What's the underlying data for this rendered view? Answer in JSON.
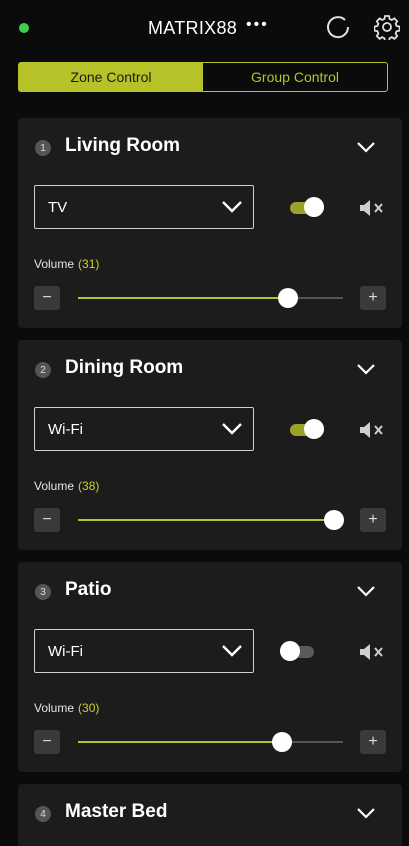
{
  "header": {
    "title": "MATRIX88",
    "menu": "•••",
    "status_color": "#3fcf4a",
    "icons": [
      "refresh-icon",
      "gear-icon"
    ]
  },
  "tabs": [
    {
      "label": "Zone Control",
      "active": true
    },
    {
      "label": "Group Control",
      "active": false
    }
  ],
  "accent": "#b6c227",
  "zones": [
    {
      "number": "1",
      "name": "Living Room",
      "source": "TV",
      "power": true,
      "volume_label": "Volume",
      "volume_value": "(31)",
      "volume_fraction": 0.79,
      "muted": false
    },
    {
      "number": "2",
      "name": "Dining Room",
      "source": "Wi-Fi",
      "power": true,
      "volume_label": "Volume",
      "volume_value": "(38)",
      "volume_fraction": 1.0,
      "muted": false
    },
    {
      "number": "3",
      "name": "Patio",
      "source": "Wi-Fi",
      "power": false,
      "volume_label": "Volume",
      "volume_value": "(30)",
      "volume_fraction": 0.77,
      "muted": false
    },
    {
      "number": "4",
      "name": "Master Bed"
    }
  ]
}
